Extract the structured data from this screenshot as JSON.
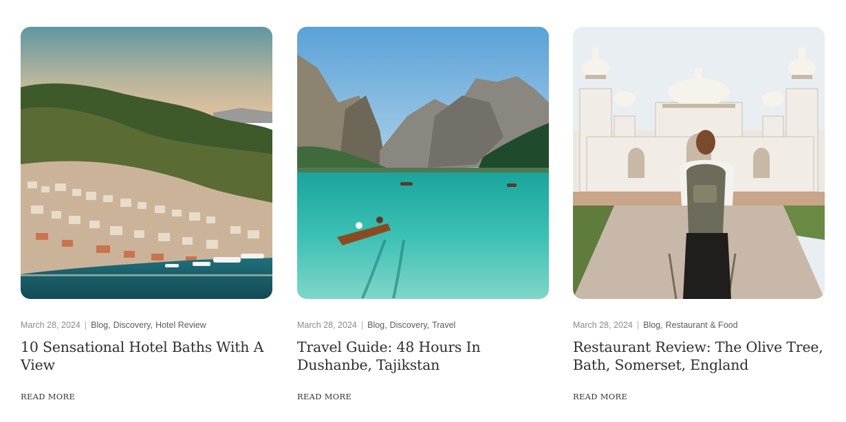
{
  "posts": [
    {
      "date": "March 28, 2024",
      "categories": [
        "Blog",
        "Discovery",
        "Hotel Review"
      ],
      "title": "10 Sensational Hotel Baths With A View",
      "read_more": "READ MORE",
      "image": "coastal-town-harbor-image"
    },
    {
      "date": "March 28, 2024",
      "categories": [
        "Blog",
        "Discovery",
        "Travel"
      ],
      "title": "Travel Guide: 48 Hours In Dushanbe, Tajikstan",
      "read_more": "READ MORE",
      "image": "mountain-lake-boat-image"
    },
    {
      "date": "March 28, 2024",
      "categories": [
        "Blog",
        "Restaurant & Food"
      ],
      "title": "Restaurant Review: The Olive Tree, Bath, Somerset, England",
      "read_more": "READ MORE",
      "image": "white-palace-traveler-image"
    }
  ],
  "colors": {
    "meta_text": "#8a8a8a",
    "category_link": "#5b5b5b",
    "title_text": "#2f2f2f",
    "background": "#ffffff"
  }
}
